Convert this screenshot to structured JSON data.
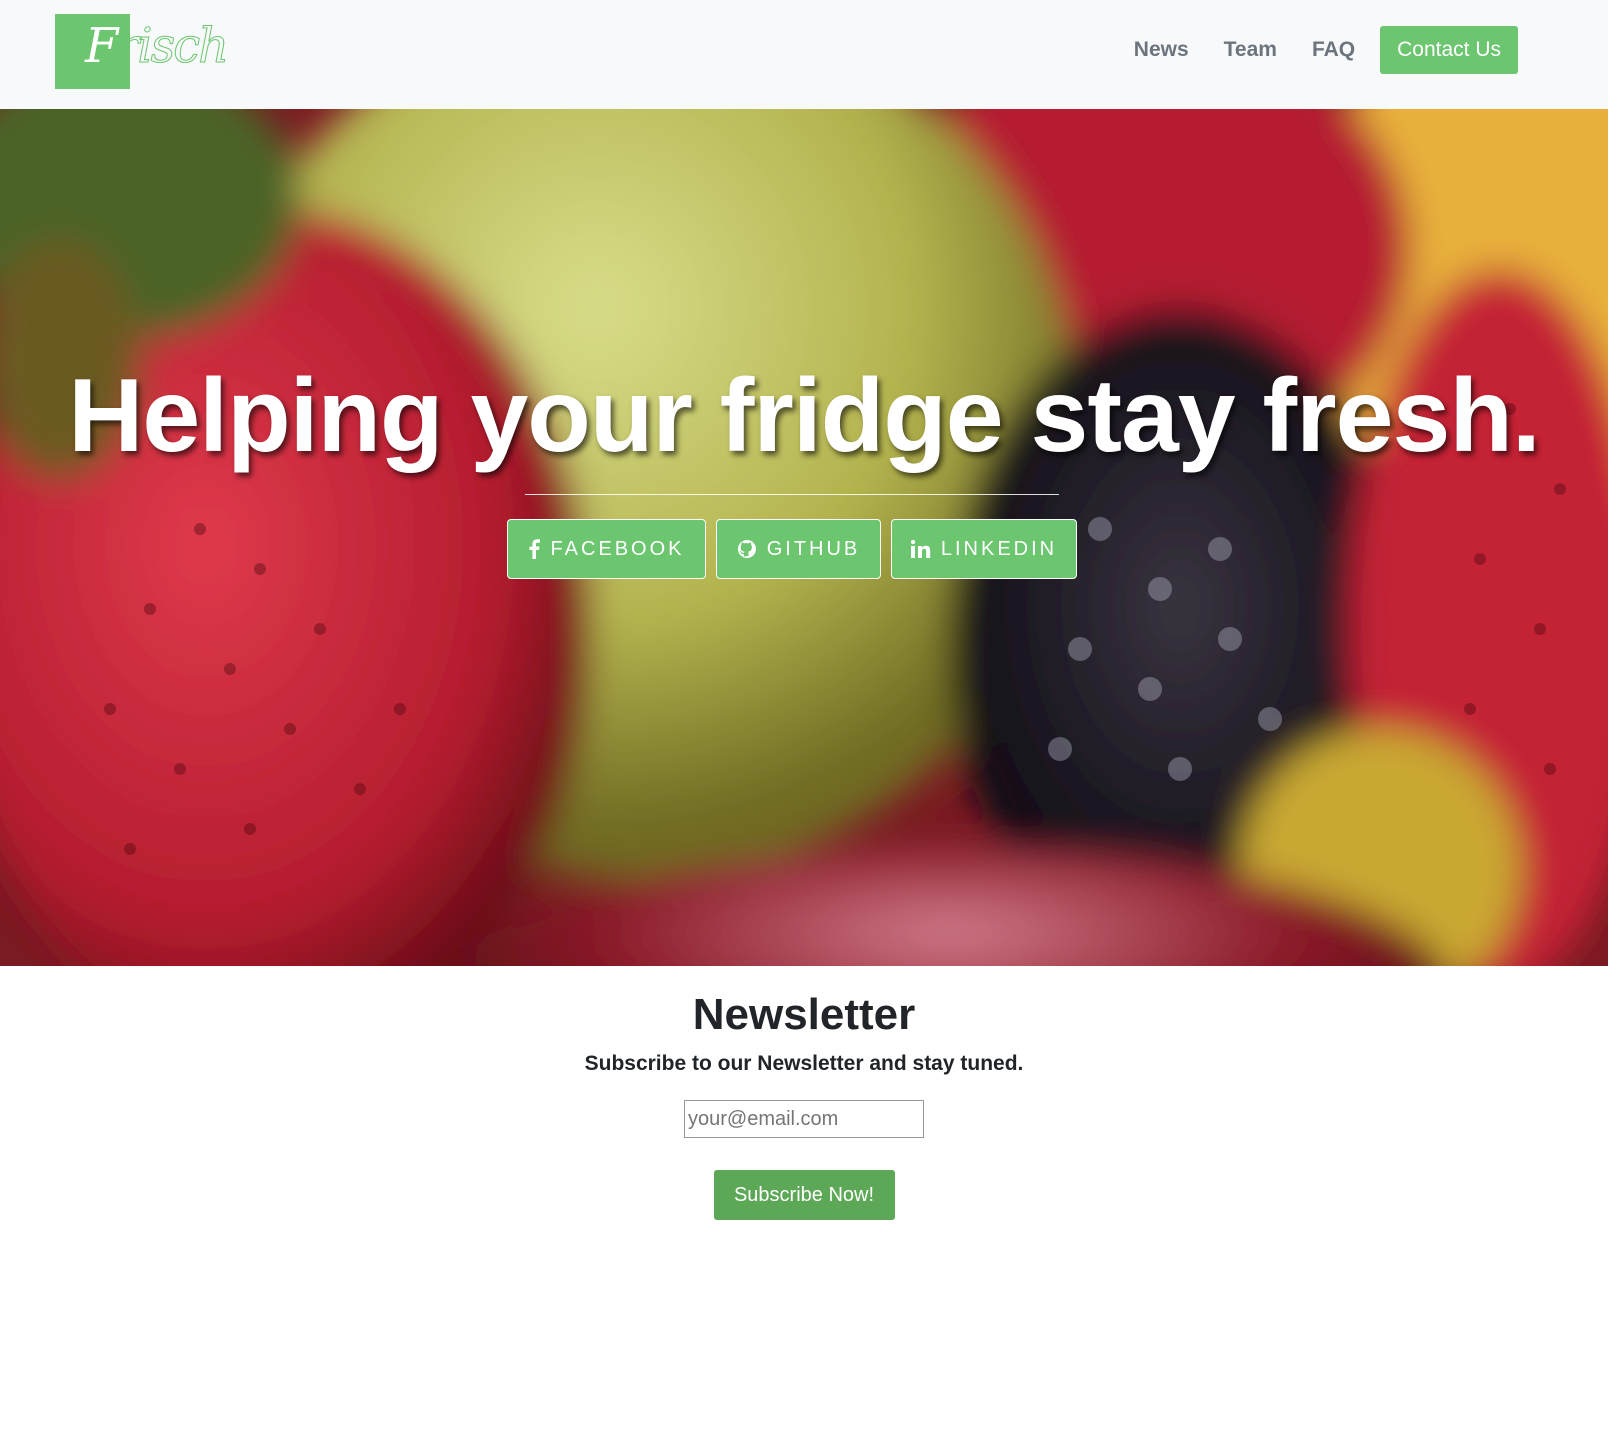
{
  "brand": {
    "logo_letter": "F",
    "logo_rest": "risch",
    "accent_color": "#6cc56f"
  },
  "nav": {
    "links": [
      "News",
      "Team",
      "FAQ"
    ],
    "cta_label": "Contact Us"
  },
  "hero": {
    "title": "Helping your fridge stay fresh.",
    "social": [
      {
        "label": "FACEBOOK",
        "icon": "facebook-icon"
      },
      {
        "label": "GITHUB",
        "icon": "github-icon"
      },
      {
        "label": "LINKEDIN",
        "icon": "linkedin-icon"
      }
    ]
  },
  "newsletter": {
    "title": "Newsletter",
    "subtitle": "Subscribe to our Newsletter and stay tuned.",
    "email_placeholder": "your@email.com",
    "button_label": "Subscribe Now!",
    "button_color": "#5ca857"
  }
}
